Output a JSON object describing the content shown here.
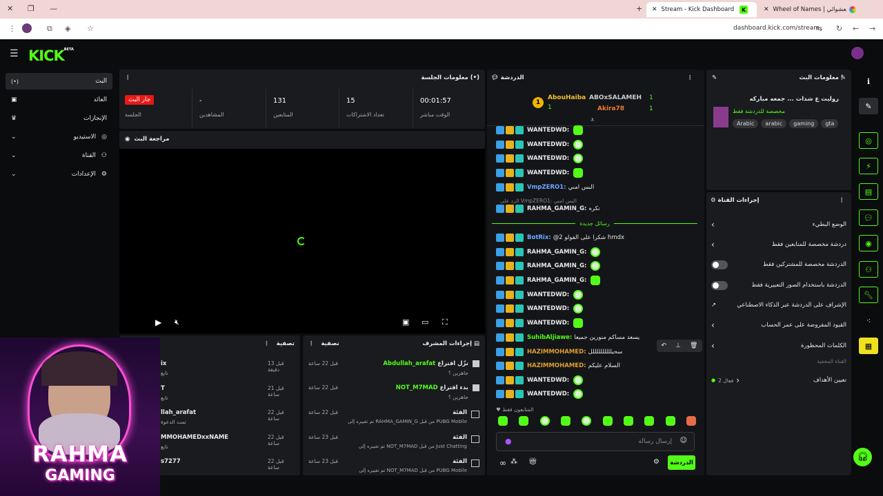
{
  "browser": {
    "tabs": [
      {
        "title": "Stream - Kick Dashboard",
        "favicon": "K"
      },
      {
        "title": "Wheel of Names | اسم العشوائي"
      }
    ],
    "url": "dashboard.kick.com/stream"
  },
  "header": {
    "logo": "KICK",
    "logo_badge": "BETA"
  },
  "sidebar": {
    "items": [
      {
        "label": "البث",
        "icon": "broadcast-icon"
      },
      {
        "label": "العائد",
        "icon": "wallet-icon"
      },
      {
        "label": "الإنجازات",
        "icon": "trophy-icon"
      },
      {
        "label": "الاستيديو",
        "icon": "studio-icon"
      },
      {
        "label": "القناة",
        "icon": "channel-icon"
      },
      {
        "label": "الإعدادات",
        "icon": "gear-icon"
      }
    ]
  },
  "session": {
    "title": "معلومات الجلسة",
    "stats": [
      {
        "value": "00:01:57",
        "label": "الوقت مباشر"
      },
      {
        "value": "15",
        "label": "تعداد الاشتراكات"
      },
      {
        "value": "131",
        "label": "المتابعين"
      },
      {
        "value": "-",
        "label": "المشاهدين"
      }
    ],
    "live_badge": "جار البث",
    "session_label": "الجلسة"
  },
  "preview": {
    "title": "مراجعة البث"
  },
  "events": {
    "title": "إجراءات المشرف",
    "filter": "تصفية",
    "items": [
      {
        "user": "Abdullah_arafat",
        "action": "نزّل اقتراع",
        "sub": "جاهزين ؟",
        "time": "قبل 22 ساعة"
      },
      {
        "user": "NOT_M7MAD",
        "action": "بدء اقتراع",
        "sub": "جاهزين ؟",
        "time": "قبل 22 ساعة"
      },
      {
        "user": "",
        "action": "الفئة",
        "sub": "PUBG Mobile من قبل RAHMA_GAMIN_G تم تغييره إلى",
        "time": "قبل 22 ساعة"
      },
      {
        "user": "",
        "action": "الفئة",
        "sub": "Just Chatting من قبل NOT_M7MAD تم تغييره إلى",
        "time": "قبل 23 ساعة"
      },
      {
        "user": "",
        "action": "الفئة",
        "sub": "PUBG Mobile من قبل NOT_M7MAD تم تغييره إلى",
        "time": "قبل 23 ساعة"
      }
    ]
  },
  "activity": {
    "filter": "تصفية",
    "items": [
      {
        "name": "ix",
        "sub": "تابع",
        "time": "قبل 13 دقيقة"
      },
      {
        "name": "T",
        "sub": "تابع",
        "time": "قبل 21 ساعة"
      },
      {
        "name": "llah_arafat",
        "sub": "تمت الدعوة",
        "time": "قبل 22 ساعة"
      },
      {
        "name": "MMOHAMEDxxNAME",
        "sub": "تابع",
        "time": "قبل 22 ساعة"
      },
      {
        "name": "s7277",
        "sub": "تابع",
        "time": "قبل 22 ساعة"
      }
    ]
  },
  "chat": {
    "title": "الدردشة",
    "leaders": [
      {
        "name": "AbouHaiba",
        "count": "1",
        "rank": "1"
      },
      {
        "name": "ABOxSALAMEH",
        "count": "1"
      },
      {
        "name": "Akira78",
        "count": "1"
      }
    ],
    "messages": [
      {
        "user": "WANTEDWD:",
        "text": "",
        "color": "#e8e8e8"
      },
      {
        "user": "WANTEDWD:",
        "text": "",
        "color": "#e8e8e8"
      },
      {
        "user": "WANTEDWD:",
        "text": "",
        "color": "#e8e8e8"
      },
      {
        "user": "WANTEDWD:",
        "text": "",
        "color": "#e8e8e8"
      },
      {
        "user": "VmpZERO1:",
        "text": "البس امني",
        "color": "#6fa8ff"
      },
      {
        "user": "",
        "text": "الرد على VmpZERO1: البس امني",
        "color": "#aaa"
      },
      {
        "user": "RAHMA_GAMIN_G:",
        "text": "نكره",
        "color": "#e8e8e8"
      }
    ],
    "new_messages": "رسائل جديدة",
    "messages2": [
      {
        "user": "BotRix:",
        "text": "@2 شكرا على الفولو hmdx",
        "color": "#6fa8ff"
      },
      {
        "user": "RAHMA_GAMIN_G:",
        "text": "",
        "color": "#e8e8e8"
      },
      {
        "user": "RAHMA_GAMIN_G:",
        "text": "",
        "color": "#e8e8e8"
      },
      {
        "user": "RAHMA_GAMIN_G:",
        "text": "",
        "color": "#e8e8e8"
      },
      {
        "user": "WANTEDWD:",
        "text": "",
        "color": "#e8e8e8"
      },
      {
        "user": "WANTEDWD:",
        "text": "",
        "color": "#e8e8e8"
      },
      {
        "user": "WANTEDWD:",
        "text": "",
        "color": "#e8e8e8"
      },
      {
        "user": "SuhibAljiawe:",
        "text": "يسعد مساكم منورين جميعا",
        "color": "#53fc18"
      },
      {
        "user": "HAZIMMOHAMED:",
        "text": "سحبللللللللللل",
        "color": "#e0a030"
      },
      {
        "user": "HAZIMMOHAMED:",
        "text": "السلام عليكم",
        "color": "#e0a030"
      },
      {
        "user": "WANTEDWD:",
        "text": "",
        "color": "#e8e8e8"
      },
      {
        "user": "WANTEDWD:",
        "text": "",
        "color": "#e8e8e8"
      }
    ],
    "followers_only": "المتابعون فقط",
    "input_placeholder": "إرسال رسالة",
    "send_label": "الدردشة"
  },
  "stream_info": {
    "title": "معلومات البث",
    "stream_title": "روليت ع شدات ... جمعه مباركه",
    "category": "مخصصة للدردشة فقط",
    "tags": [
      "Arabic",
      "arabic",
      "gaming",
      "gta"
    ]
  },
  "channel_actions": {
    "title": "إجراءات القناة",
    "rows": [
      {
        "label": "الوضع البطيء",
        "control": "chevron"
      },
      {
        "label": "دردشة مخصصة للمتابعين فقط",
        "control": "chevron"
      },
      {
        "label": "الدردشة مخصصة للمشتركين فقط",
        "control": "toggle"
      },
      {
        "label": "الدردشة باستخدام الصور التعبيرية فقط",
        "control": "toggle"
      },
      {
        "label": "الإشراف على الدردشة عبر الذكاء الاصطناعي",
        "control": "external"
      },
      {
        "label": "القيود المفروضة على عمر الحساب",
        "control": "chevron"
      },
      {
        "label": "الكلمات المحظورة",
        "control": "chevron"
      }
    ],
    "hidden_label": "القناة المخفية",
    "goals_label": "تعيين الأهداف",
    "goals_value": "فعال 2"
  },
  "streamer_overlay": {
    "line1": "RAHMA",
    "line2": "GAMING"
  },
  "colors": {
    "accent": "#53fc18",
    "panel": "#191b1f",
    "bg": "#0b0c0d",
    "live": "#e91916"
  }
}
